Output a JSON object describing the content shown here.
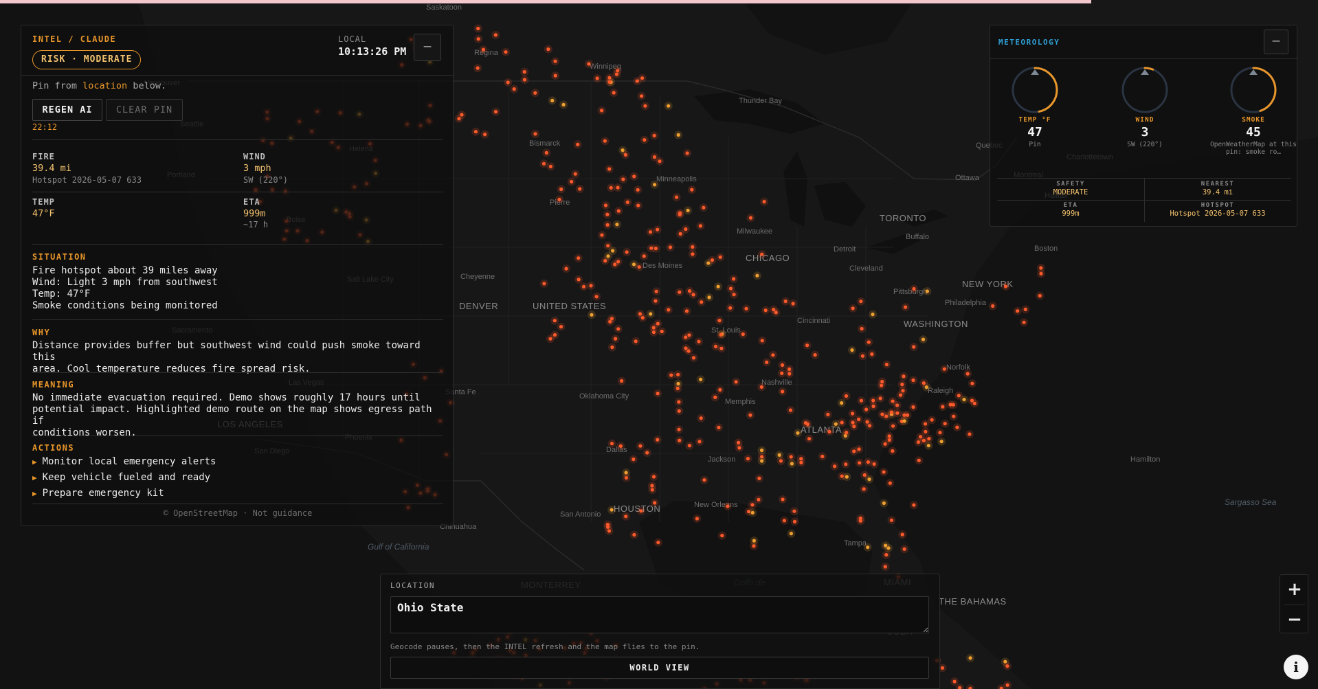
{
  "map": {
    "labels": [
      {
        "text": "Saskatoon"
      },
      {
        "text": "Regina"
      },
      {
        "text": "Winnipeg"
      },
      {
        "text": "Vancouver"
      },
      {
        "text": "Seattle"
      },
      {
        "text": "Helena"
      },
      {
        "text": "Bismarck"
      },
      {
        "text": "Thunder Bay"
      },
      {
        "text": "Portland"
      },
      {
        "text": "Pierre"
      },
      {
        "text": "Montreal"
      },
      {
        "text": "Quebec"
      },
      {
        "text": "Ottawa"
      },
      {
        "text": "Minneapolis"
      },
      {
        "text": "Milwaukee"
      },
      {
        "text": "TORONTO"
      },
      {
        "text": "Boise"
      },
      {
        "text": "Detroit"
      },
      {
        "text": "Buffalo"
      },
      {
        "text": "Boston"
      },
      {
        "text": "CHICAGO"
      },
      {
        "text": "Cleveland"
      },
      {
        "text": "Salt Lake City"
      },
      {
        "text": "Cheyenne"
      },
      {
        "text": "Des Moines"
      },
      {
        "text": "Pittsburgh"
      },
      {
        "text": "NEW YORK"
      },
      {
        "text": "Philadelphia"
      },
      {
        "text": "DENVER"
      },
      {
        "text": "UNITED STATES"
      },
      {
        "text": "Sacramento"
      },
      {
        "text": "Cincinnati"
      },
      {
        "text": "WASHINGTON"
      },
      {
        "text": "St. Louis"
      },
      {
        "text": "Norfolk"
      },
      {
        "text": "Las Vegas"
      },
      {
        "text": "Santa Fe"
      },
      {
        "text": "Oklahoma City"
      },
      {
        "text": "Nashville"
      },
      {
        "text": "Raleigh"
      },
      {
        "text": "Memphis"
      },
      {
        "text": "LOS ANGELES"
      },
      {
        "text": "ATLANTA"
      },
      {
        "text": "San Diego"
      },
      {
        "text": "Phoenix"
      },
      {
        "text": "Dallas"
      },
      {
        "text": "Jackson"
      },
      {
        "text": "Hamilton"
      },
      {
        "text": "HOUSTON"
      },
      {
        "text": "New Orleans"
      },
      {
        "text": "San Antonio"
      },
      {
        "text": "Chihuahua"
      },
      {
        "text": "Tampa"
      },
      {
        "text": "Sargasso Sea"
      },
      {
        "text": "Gulf of California"
      },
      {
        "text": "MIAMI"
      },
      {
        "text": "MONTERREY"
      },
      {
        "text": "Golfo de"
      },
      {
        "text": "THE BAHAMAS"
      },
      {
        "text": "CUBA"
      },
      {
        "text": "Halifax"
      },
      {
        "text": "Charlottetown"
      }
    ]
  },
  "intel": {
    "brand": "INTEL / CLAUDE",
    "risk": "RISK · MODERATE",
    "local_label": "LOCAL",
    "local_time": "10:13:26 PM",
    "collapse": "—",
    "pin_hint_pre": "Pin from ",
    "pin_hint_link": "location",
    "pin_hint_post": " below.",
    "regen_label": "REGEN AI",
    "clear_label": "CLEAR PIN",
    "gen_time": "22:12",
    "fire_label": "FIRE",
    "fire_value": "39.4 mi",
    "fire_sub": "Hotspot 2026-05-07 633",
    "wind_label": "WIND",
    "wind_value": "3 mph",
    "wind_sub": "SW (220°)",
    "temp_label": "TEMP",
    "temp_value": "47°F",
    "eta_label": "ETA",
    "eta_value": "999m",
    "eta_sub": "~17 h",
    "situation_title": "SITUATION",
    "situation_text": "Fire hotspot about 39 miles away\nWind: Light 3 mph from southwest\nTemp: 47°F\nSmoke conditions being monitored",
    "why_title": "WHY",
    "why_text": "Distance provides buffer but southwest wind could push smoke toward this\narea. Cool temperature reduces fire spread risk.",
    "meaning_title": "MEANING",
    "meaning_text": "No immediate evacuation required. Demo shows roughly 17 hours until\npotential impact. Highlighted demo route on the map shows egress path if\nconditions worsen.",
    "actions_title": "ACTIONS",
    "actions": [
      "Monitor local emergency alerts",
      "Keep vehicle fueled and ready",
      "Prepare emergency kit"
    ],
    "footer": "© OpenStreetMap · Not guidance"
  },
  "meteo": {
    "title": "METEOROLOGY",
    "collapse": "—",
    "gauges": [
      {
        "label": "TEMP °F",
        "value": "47",
        "sub": "Pin",
        "fraction": 0.47,
        "color": "#e8962a"
      },
      {
        "label": "WIND",
        "value": "3",
        "sub": "SW (220°)",
        "fraction": 0.06,
        "color": "#e8962a"
      },
      {
        "label": "SMOKE",
        "value": "45",
        "sub": "OpenWeatherMap at this pin: smoke ro…",
        "fraction": 0.45,
        "color": "#e8962a"
      }
    ],
    "safety_label": "SAFETY",
    "safety_value": "MODERATE",
    "nearest_label": "NEAREST",
    "nearest_value": "39.4 mi",
    "eta_label": "ETA",
    "eta_value": "999m",
    "hotspot_label": "HOTSPOT",
    "hotspot_value": "Hotspot 2026-05-07 633"
  },
  "location": {
    "label": "LOCATION",
    "value": "Ohio State",
    "hint": "Geocode pauses, then the INTEL refresh and the map flies to the pin.",
    "world_view": "WORLD VIEW"
  },
  "zoom": {
    "in": "+",
    "out": "−"
  },
  "info": "i",
  "colors": {
    "accent": "#e8962a",
    "hotspot": "#ff5a2a",
    "meteo_title": "#2f9ed4",
    "value": "#f3c26d"
  }
}
